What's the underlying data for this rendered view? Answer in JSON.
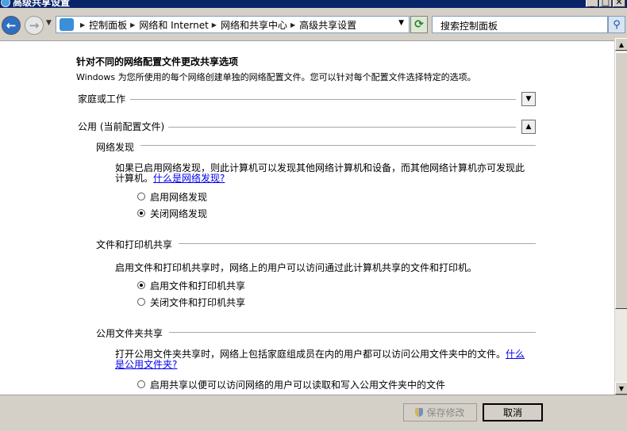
{
  "window": {
    "title": "高级共享设置",
    "min_glyph": "_",
    "max_glyph": "□",
    "close_glyph": "✕"
  },
  "address_bar": {
    "breadcrumbs": [
      "控制面板",
      "网络和 Internet",
      "网络和共享中心",
      "高级共享设置"
    ],
    "search_placeholder": "搜索控制面板"
  },
  "page": {
    "heading": "针对不同的网络配置文件更改共享选项",
    "description": "Windows 为您所使用的每个网络创建单独的网络配置文件。您可以针对每个配置文件选择特定的选项。",
    "profiles": {
      "home_work": {
        "label": "家庭或工作",
        "expanded": false
      },
      "public": {
        "label": "公用 (当前配置文件)",
        "expanded": true
      }
    },
    "network_discovery": {
      "title": "网络发现",
      "desc_line1": "如果已启用网络发现，则此计算机可以发现其他网络计算机和设备，而其他网络计算机亦可发现此",
      "desc_line2": "计算机。",
      "link": "什么是网络发现?",
      "options": [
        {
          "label": "启用网络发现",
          "selected": false
        },
        {
          "label": "关闭网络发现",
          "selected": true
        }
      ]
    },
    "file_printer_sharing": {
      "title": "文件和打印机共享",
      "desc": "启用文件和打印机共享时，网络上的用户可以访问通过此计算机共享的文件和打印机。",
      "options": [
        {
          "label": "启用文件和打印机共享",
          "selected": true
        },
        {
          "label": "关闭文件和打印机共享",
          "selected": false
        }
      ]
    },
    "public_folder_sharing": {
      "title": "公用文件夹共享",
      "desc_line1": "打开公用文件夹共享时，网络上包括家庭组成员在内的用户都可以访问公用文件夹中的文件。",
      "link_part1": "什么",
      "link_part2": "是公用文件夹?",
      "options": [
        {
          "label": "启用共享以便可以访问网络的用户可以读取和写入公用文件夹中的文件",
          "selected": false
        }
      ]
    }
  },
  "footer": {
    "save_label": "保存修改",
    "cancel_label": "取消"
  },
  "icons": {
    "back": "back-arrow-icon",
    "forward": "forward-arrow-icon",
    "refresh": "refresh-icon",
    "search": "search-icon",
    "shield": "uac-shield-icon"
  }
}
